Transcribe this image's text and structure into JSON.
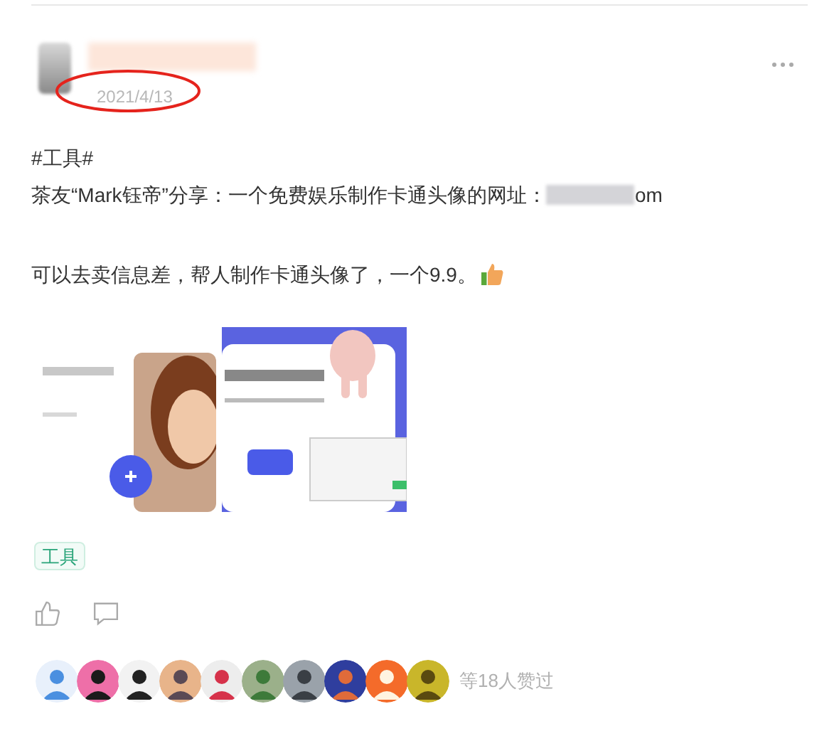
{
  "post": {
    "date": "2021/4/13",
    "date_circled": true,
    "lines": [
      {
        "kind": "hashtag",
        "text": "#工具#"
      },
      {
        "kind": "link_line",
        "text": "茶友“Mark钰帝”分享：一个免费娱乐制作卡通头像的网址：",
        "tail": "om"
      },
      {
        "kind": "emoji_line",
        "text": "可以去卖信息差，帮人制作卡通头像了，一个9.9。"
      }
    ],
    "images": [
      {
        "kind": "picture"
      },
      {
        "kind": "picture"
      }
    ],
    "tags": [
      "工具"
    ],
    "likers": [
      {
        "kind": "picture"
      },
      {
        "kind": "picture"
      },
      {
        "kind": "picture"
      },
      {
        "kind": "picture"
      },
      {
        "kind": "picture"
      },
      {
        "kind": "picture"
      },
      {
        "kind": "picture"
      },
      {
        "kind": "picture"
      },
      {
        "kind": "picture"
      },
      {
        "kind": "picture"
      }
    ],
    "likes_text": "等18人赞过"
  }
}
